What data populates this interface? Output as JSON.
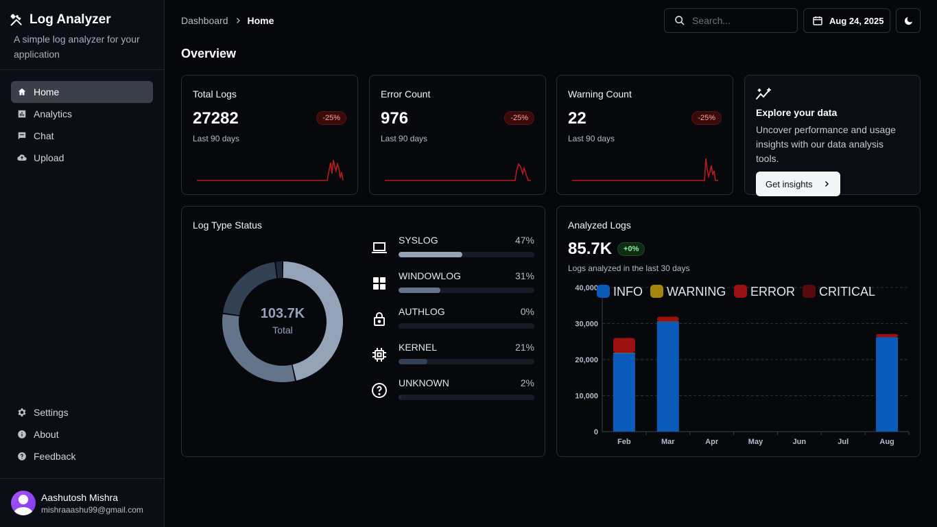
{
  "sidebar": {
    "title": "Log Analyzer",
    "subtitle": "A simple log analyzer for your application",
    "nav": [
      {
        "label": "Home",
        "icon": "home-icon",
        "active": true
      },
      {
        "label": "Analytics",
        "icon": "analytics-icon"
      },
      {
        "label": "Chat",
        "icon": "chat-icon"
      },
      {
        "label": "Upload",
        "icon": "upload-icon"
      }
    ],
    "bottom_nav": [
      {
        "label": "Settings",
        "icon": "gear-icon"
      },
      {
        "label": "About",
        "icon": "info-icon"
      },
      {
        "label": "Feedback",
        "icon": "help-icon"
      }
    ],
    "user": {
      "name": "Aashutosh Mishra",
      "email": "mishraaashu99@gmail.com"
    }
  },
  "header": {
    "breadcrumb": [
      "Dashboard",
      "Home"
    ],
    "search_placeholder": "Search...",
    "date": "Aug 24, 2025"
  },
  "page_title": "Overview",
  "stats": [
    {
      "label": "Total Logs",
      "value": "27282",
      "change": "-25%",
      "sub": "Last 90 days",
      "color": "#b91c1c"
    },
    {
      "label": "Error Count",
      "value": "976",
      "change": "-25%",
      "sub": "Last 90 days",
      "color": "#b91c1c"
    },
    {
      "label": "Warning Count",
      "value": "22",
      "change": "-25%",
      "sub": "Last 90 days",
      "color": "#b91c1c"
    }
  ],
  "explore": {
    "title": "Explore your data",
    "description": "Uncover performance and usage insights with our data analysis tools.",
    "button": "Get insights"
  },
  "log_type": {
    "title": "Log Type Status",
    "total": "103.7K",
    "total_label": "Total",
    "items": [
      {
        "name": "SYSLOG",
        "pct": "47%",
        "value": 47,
        "color": "#94a3b8",
        "icon": "laptop-icon"
      },
      {
        "name": "WINDOWLOG",
        "pct": "31%",
        "value": 31,
        "color": "#64748b",
        "icon": "windows-icon"
      },
      {
        "name": "AUTHLOG",
        "pct": "0%",
        "value": 0,
        "color": "#475569",
        "icon": "lock-icon"
      },
      {
        "name": "KERNEL",
        "pct": "21%",
        "value": 21,
        "color": "#334155",
        "icon": "cpu-icon"
      },
      {
        "name": "UNKNOWN",
        "pct": "2%",
        "value": 2,
        "color": "#1e293b",
        "icon": "question-icon"
      }
    ]
  },
  "analyzed": {
    "title": "Analyzed Logs",
    "value": "85.7K",
    "change": "+0%",
    "sub": "Logs analyzed in the last 30 days"
  },
  "chart_data": {
    "type": "bar",
    "stacked": true,
    "categories": [
      "Feb",
      "Mar",
      "Apr",
      "May",
      "Jun",
      "Jul",
      "Aug"
    ],
    "series": [
      {
        "name": "INFO",
        "color": "#0b5cba",
        "values": [
          21800,
          30500,
          0,
          0,
          0,
          0,
          26200
        ]
      },
      {
        "name": "WARNING",
        "color": "#a6850f",
        "values": [
          100,
          100,
          0,
          0,
          0,
          0,
          0
        ]
      },
      {
        "name": "ERROR",
        "color": "#9b1111",
        "values": [
          4100,
          1300,
          0,
          0,
          0,
          0,
          900
        ]
      },
      {
        "name": "CRITICAL",
        "color": "#5a0a0a",
        "values": [
          0,
          0,
          0,
          0,
          0,
          0,
          0
        ]
      }
    ],
    "ylim": [
      0,
      40000
    ],
    "yticks": [
      "0",
      "10,000",
      "20,000",
      "30,000",
      "40,000"
    ],
    "grid": true,
    "legend": "top"
  }
}
